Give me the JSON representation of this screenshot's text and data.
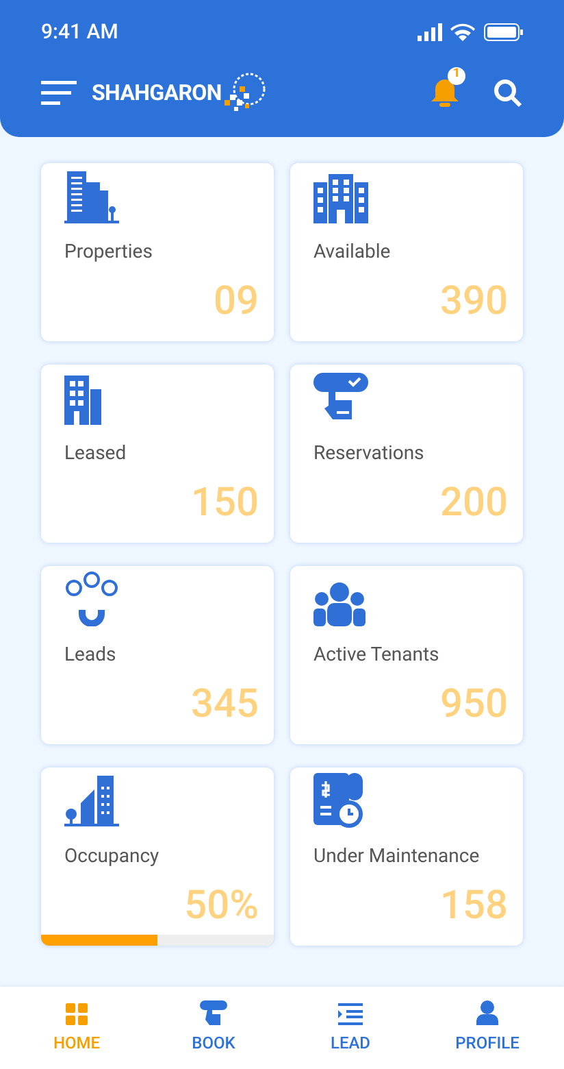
{
  "status_bar": {
    "time": "9:41 AM"
  },
  "header": {
    "logo": "SHAHGARON",
    "notification_count": "1"
  },
  "cards": [
    {
      "kind": "stat",
      "label": "Properties",
      "value": "09"
    },
    {
      "kind": "stat",
      "label": "Available",
      "value": "390"
    },
    {
      "kind": "stat",
      "label": "Leased",
      "value": "150"
    },
    {
      "kind": "stat",
      "label": "Reservations",
      "value": "200"
    },
    {
      "kind": "stat",
      "label": "Leads",
      "value": "345"
    },
    {
      "kind": "stat",
      "label": "Active Tenants",
      "value": "950"
    },
    {
      "kind": "progress",
      "label": "Occupancy",
      "value": "50%",
      "level": 0.5
    },
    {
      "kind": "stat",
      "label": "Under Maintenance",
      "value": "158"
    }
  ],
  "bottom_nav": [
    {
      "label": "HOME",
      "selected": true
    },
    {
      "label": "BOOK",
      "selected": false
    },
    {
      "label": "LEAD",
      "selected": false
    },
    {
      "label": "PROFILE",
      "selected": false
    }
  ]
}
